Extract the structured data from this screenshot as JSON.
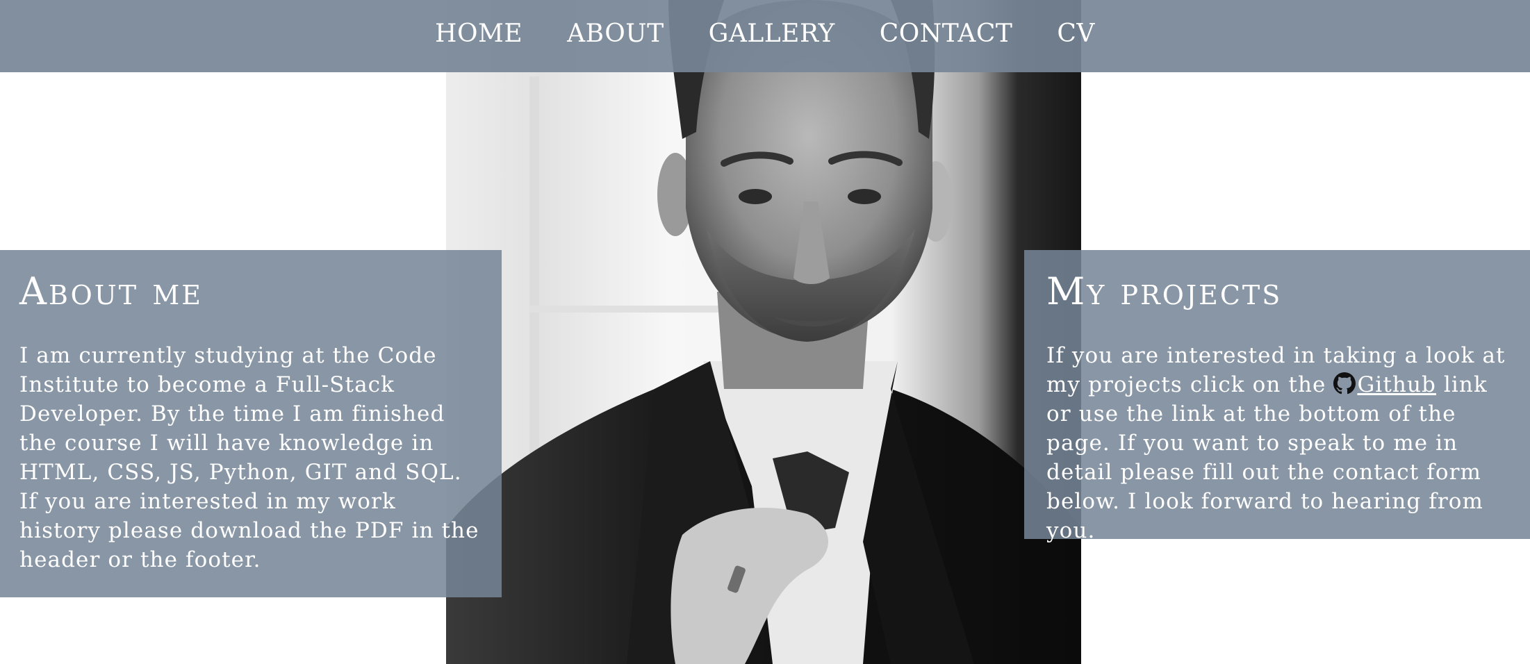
{
  "nav": {
    "items": [
      {
        "label": "HOME"
      },
      {
        "label": "ABOUT"
      },
      {
        "label": "GALLERY"
      },
      {
        "label": "CONTACT"
      },
      {
        "label": "CV"
      }
    ]
  },
  "about": {
    "title": "About me",
    "text": "I am currently studying at the Code Institute to become a Full-Stack Developer. By the time I am finished the course I will have knowledge in HTML, CSS, JS, Python, GIT and SQL. If you are interested in my work history please download the PDF in the header or the footer."
  },
  "projects": {
    "title": "My projects",
    "text_before": "If you are interested in taking a look at my projects click on the ",
    "link_label": "Github",
    "text_after": " link or use the link at the bottom of the page. If you want to speak to me in detail please fill out the contact form below. I look forward to hearing from you.",
    "icon": "github-icon"
  },
  "colors": {
    "panel": "#768596",
    "text": "#ffffff"
  }
}
